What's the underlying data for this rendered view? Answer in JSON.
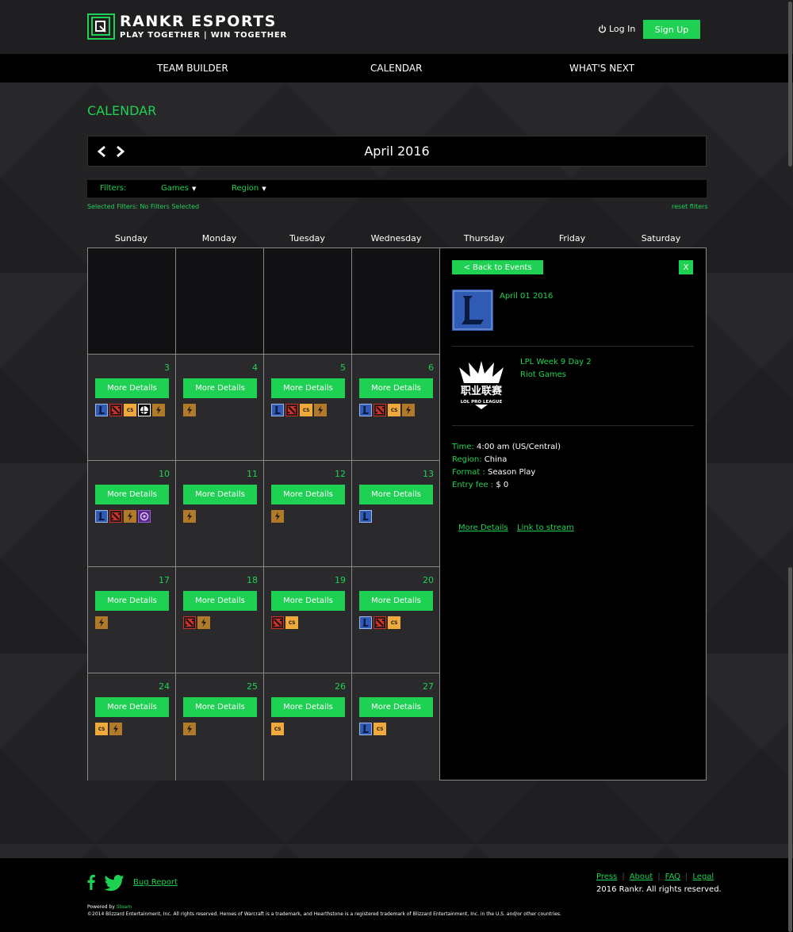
{
  "brand": {
    "title": "RANKR ESPORTS",
    "tagline": "PLAY TOGETHER | WIN TOGETHER",
    "accent": "#1fd153"
  },
  "header": {
    "login_label": "Log In",
    "signup_label": "Sign Up"
  },
  "nav": {
    "team_builder": "TEAM BUILDER",
    "calendar": "CALENDAR",
    "whats_next": "WHAT'S NEXT"
  },
  "page": {
    "title": "CALENDAR",
    "month_label": "April 2016"
  },
  "filters": {
    "label": "Filters:",
    "games": "Games",
    "region": "Region",
    "selected": "Selected Filters: No Filters Selected",
    "reset": "reset filters"
  },
  "weekdays": [
    "Sunday",
    "Monday",
    "Tuesday",
    "Wednesday",
    "Thursday",
    "Friday",
    "Saturday"
  ],
  "calendar": {
    "more_details_label": "More Details",
    "rows": [
      [
        {
          "day": "",
          "empty": true,
          "icons": []
        },
        {
          "day": "",
          "empty": true,
          "icons": []
        },
        {
          "day": "",
          "empty": true,
          "icons": []
        },
        {
          "day": "",
          "empty": true,
          "icons": []
        }
      ],
      [
        {
          "day": "3",
          "icons": [
            "lol-icon",
            "dota-icon",
            "cs-icon",
            "smash-icon",
            "hearthstone-icon"
          ]
        },
        {
          "day": "4",
          "icons": [
            "hearthstone-icon"
          ]
        },
        {
          "day": "5",
          "icons": [
            "lol-icon",
            "dota-icon",
            "cs-icon",
            "hearthstone-icon"
          ]
        },
        {
          "day": "6",
          "icons": [
            "lol-icon",
            "dota-icon",
            "cs-icon",
            "hearthstone-icon"
          ]
        }
      ],
      [
        {
          "day": "10",
          "icons": [
            "lol-icon",
            "dota-icon",
            "hearthstone-icon",
            "hots-icon"
          ]
        },
        {
          "day": "11",
          "icons": [
            "hearthstone-icon"
          ]
        },
        {
          "day": "12",
          "icons": [
            "hearthstone-icon"
          ]
        },
        {
          "day": "13",
          "icons": [
            "lol-icon"
          ]
        }
      ],
      [
        {
          "day": "17",
          "icons": [
            "hearthstone-icon"
          ]
        },
        {
          "day": "18",
          "icons": [
            "dota-icon",
            "hearthstone-icon"
          ]
        },
        {
          "day": "19",
          "icons": [
            "dota-icon",
            "cs-icon"
          ]
        },
        {
          "day": "20",
          "icons": [
            "lol-icon",
            "dota-icon",
            "cs-icon"
          ]
        }
      ],
      [
        {
          "day": "24",
          "icons": [
            "cs-icon",
            "hearthstone-icon"
          ]
        },
        {
          "day": "25",
          "icons": [
            "hearthstone-icon"
          ]
        },
        {
          "day": "26",
          "icons": [
            "cs-icon"
          ]
        },
        {
          "day": "27",
          "icons": [
            "lol-icon",
            "cs-icon"
          ]
        }
      ]
    ]
  },
  "detail": {
    "back_label": "< Back to Events",
    "close_label": "X",
    "date": "April 01 2016",
    "event_name": "LPL Week 9 Day 2",
    "organizer": "Riot Games",
    "league_logo_text": "职业联赛",
    "league_logo_sub": "LOL PRO LEAGUE",
    "time_label": "Time:",
    "time_value": "4:00 am (US/Central)",
    "region_label": "Region:",
    "region_value": "China",
    "format_label": "Format :",
    "format_value": "Season Play",
    "fee_label": "Entry fee :",
    "fee_value": "$ 0",
    "more_details": "More Details",
    "stream_link": "Link to stream"
  },
  "footer": {
    "bug_report": "Bug Report",
    "powered_by": "Powered by",
    "powered_name": "Steam",
    "legal_text": "©2014 Blizzard Entertainment, Inc. All rights reserved. Heroes of Warcraft is a trademark, and Hearthstone is a registered trademark of Blizzard Entertainment, Inc. in the U.S. and/or other countries.",
    "links": [
      "Press",
      "About",
      "FAQ",
      "Legal"
    ],
    "copyright": "2016 Rankr. All rights reserved."
  }
}
